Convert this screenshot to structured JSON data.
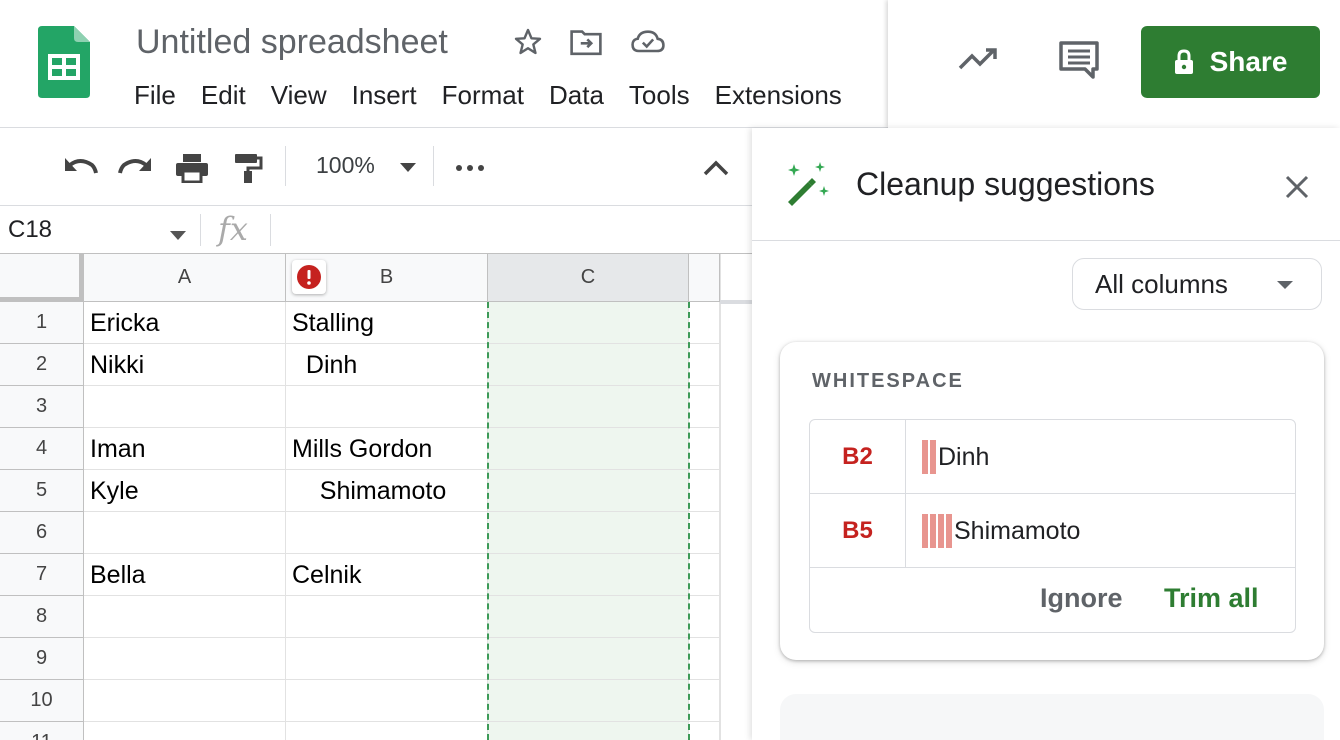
{
  "header": {
    "title": "Untitled spreadsheet",
    "menu": [
      "File",
      "Edit",
      "View",
      "Insert",
      "Format",
      "Data",
      "Tools",
      "Extensions"
    ],
    "share_label": "Share"
  },
  "toolbar": {
    "zoom": "100%"
  },
  "formula_bar": {
    "cell_ref": "C18",
    "fx": "fx"
  },
  "grid": {
    "columns": [
      "A",
      "B",
      "C"
    ],
    "rows": [
      {
        "num": "1",
        "a": "Ericka",
        "b": "Stalling"
      },
      {
        "num": "2",
        "a": "Nikki",
        "b": "  Dinh"
      },
      {
        "num": "3",
        "a": "",
        "b": ""
      },
      {
        "num": "4",
        "a": "Iman",
        "b": "Mills Gordon"
      },
      {
        "num": "5",
        "a": "Kyle",
        "b": "    Shimamoto"
      },
      {
        "num": "6",
        "a": "",
        "b": ""
      },
      {
        "num": "7",
        "a": "Bella",
        "b": "Celnik"
      },
      {
        "num": "8",
        "a": "",
        "b": ""
      },
      {
        "num": "9",
        "a": "",
        "b": ""
      },
      {
        "num": "10",
        "a": "",
        "b": ""
      },
      {
        "num": "11",
        "a": "",
        "b": ""
      }
    ]
  },
  "panel": {
    "title": "Cleanup suggestions",
    "columns_filter": "All columns",
    "whitespace_card": {
      "title": "WHITESPACE",
      "items": [
        {
          "ref": "B2",
          "leading_spaces": 2,
          "text": "Dinh"
        },
        {
          "ref": "B5",
          "leading_spaces": 4,
          "text": "Shimamoto"
        }
      ],
      "ignore_label": "Ignore",
      "trim_label": "Trim all"
    }
  },
  "colors": {
    "brand_green": "#2e7d32",
    "error_red": "#c5221f",
    "selection_fill": "#eef6ef",
    "whitespace_marker": "#e8958f"
  }
}
